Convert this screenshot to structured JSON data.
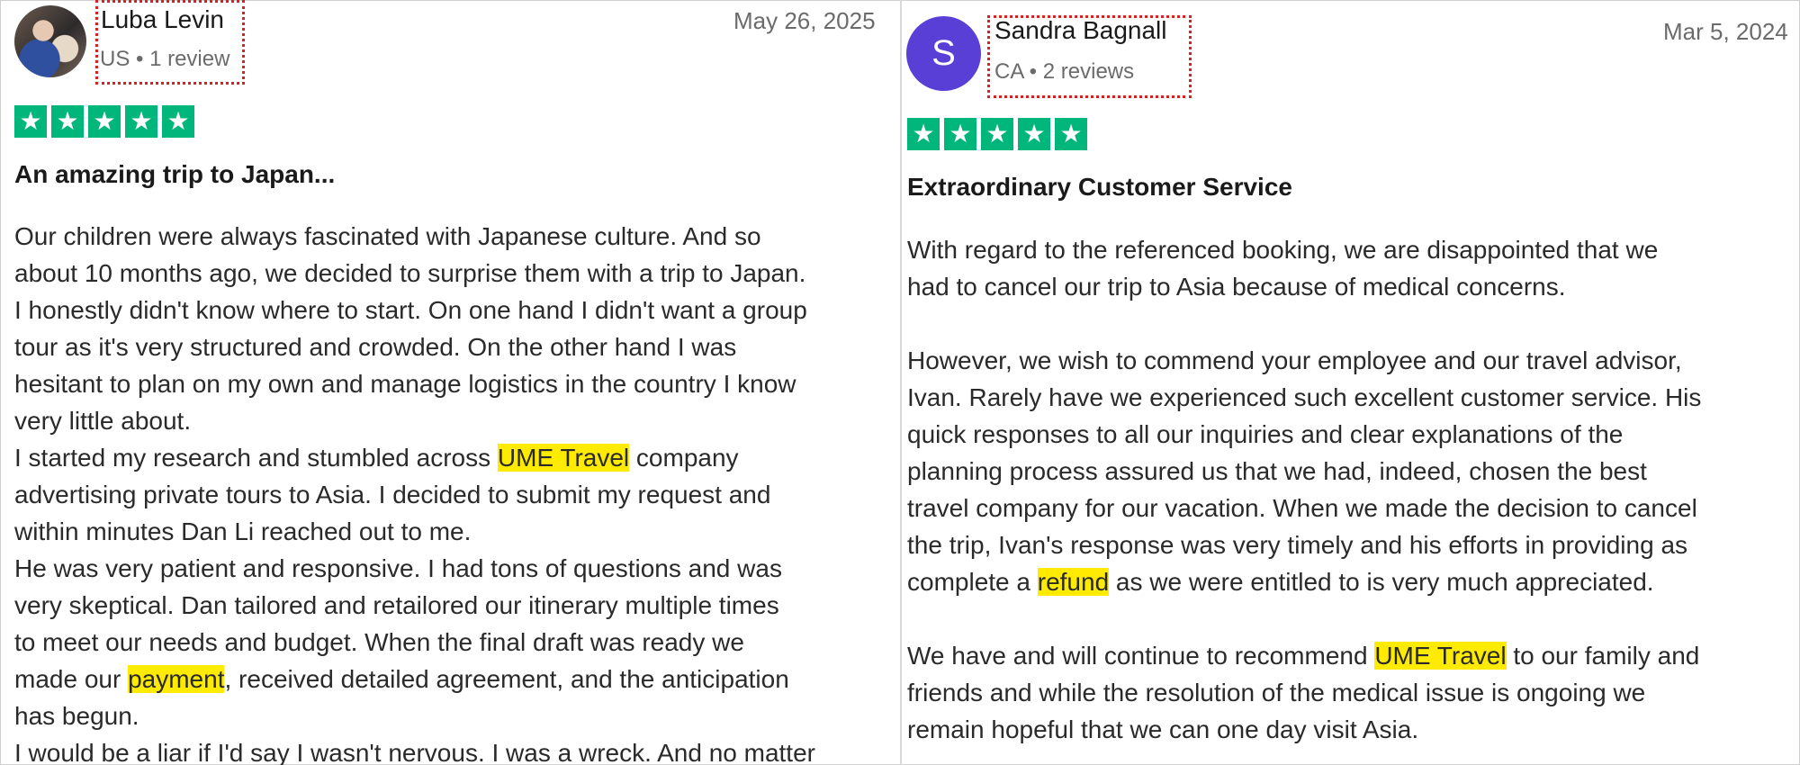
{
  "reviews": [
    {
      "author": "Luba Levin",
      "meta": "US • 1 review",
      "date": "May 26, 2025",
      "rating": 5,
      "title": "An amazing trip to Japan...",
      "lines": [
        [
          "Our children were always fascinated with Japanese culture. And so"
        ],
        [
          "about 10 months ago, we decided to surprise them with a trip to Japan."
        ],
        [
          "I honestly didn't know where to start. On one hand I didn't want a group"
        ],
        [
          "tour as it's very structured and crowded. On the other hand I was"
        ],
        [
          "hesitant to plan on my own and manage logistics in the country I know"
        ],
        [
          "very little about."
        ],
        [
          "I started my research and stumbled across ",
          "UME Travel",
          " company"
        ],
        [
          "advertising private tours to Asia. I decided to submit my request and"
        ],
        [
          "within minutes Dan Li reached out to me."
        ],
        [
          "He was very patient and responsive. I had tons of questions and was"
        ],
        [
          "very skeptical. Dan tailored and retailored our itinerary multiple times"
        ],
        [
          "to meet our needs and budget. When the final draft was ready we"
        ],
        [
          "made our ",
          "payment",
          ", received detailed agreement, and the anticipation"
        ],
        [
          "has begun."
        ],
        [
          "I would be a liar if I'd say I wasn't nervous. I was a wreck. And no matter"
        ]
      ]
    },
    {
      "author": "Sandra Bagnall",
      "avatar_initial": "S",
      "meta": "CA • 2 reviews",
      "date": "Mar 5, 2024",
      "rating": 5,
      "title": "Extraordinary Customer Service",
      "lines": [
        [
          "With regard to the referenced booking, we are disappointed that we"
        ],
        [
          "had to cancel our trip to Asia because of medical concerns."
        ],
        [
          ""
        ],
        [
          "However, we wish to commend your employee and our travel advisor,"
        ],
        [
          "Ivan. Rarely have we experienced such excellent customer service. His"
        ],
        [
          "quick responses to all our inquiries and clear explanations of the"
        ],
        [
          "planning process assured us that we had, indeed, chosen the best"
        ],
        [
          "travel company for our vacation. When we made the decision to cancel"
        ],
        [
          "the trip, Ivan's response was very timely and his efforts in providing as"
        ],
        [
          "complete a ",
          "refund",
          " as we were entitled to is very much appreciated."
        ],
        [
          ""
        ],
        [
          "We have and will continue to recommend ",
          "UME Travel",
          " to our family and"
        ],
        [
          "friends and while the resolution of the medical issue is ongoing we"
        ],
        [
          "remain hopeful that we can one day visit Asia."
        ]
      ]
    }
  ],
  "highlight_color": "#ffeb00",
  "star_color": "#00b67a",
  "avatar_color": "#5a3fd6"
}
